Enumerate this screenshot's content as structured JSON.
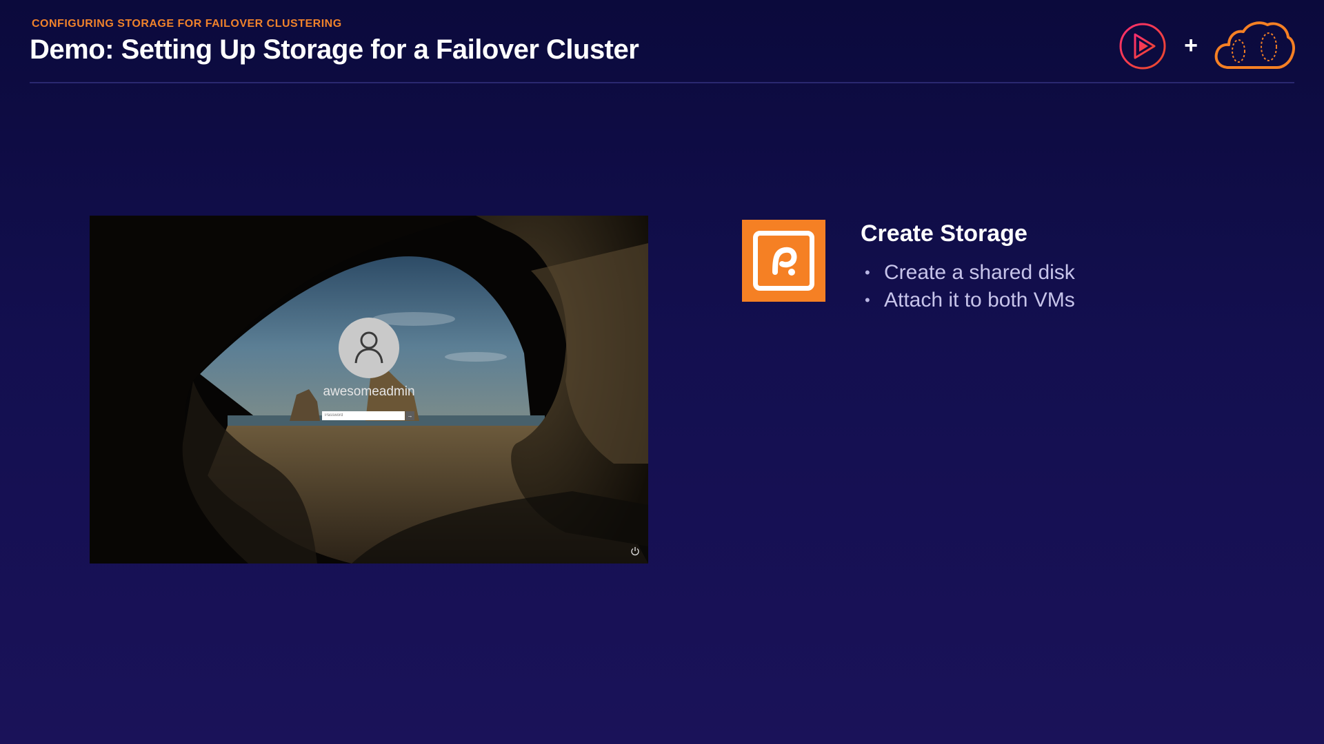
{
  "header": {
    "kicker": "CONFIGURING STORAGE FOR FAILOVER CLUSTERING",
    "title": "Demo: Setting Up Storage for a Failover Cluster",
    "plus": "+",
    "logos": [
      "play-logo-icon",
      "cloud-logo-icon"
    ]
  },
  "login_screen": {
    "username": "awesomeadmin",
    "password_placeholder": "Password",
    "submit_glyph": "→",
    "icons": [
      "user-avatar-icon",
      "power-icon"
    ]
  },
  "content": {
    "heading": "Create Storage",
    "bullets": [
      "Create a shared disk",
      "Attach it to both VMs"
    ],
    "icon": "storage-icon"
  },
  "colors": {
    "accent_orange": "#f58024",
    "background_top": "#0b0a3c",
    "background_bottom": "#1a1259",
    "brand_pink": "#e2245c"
  }
}
